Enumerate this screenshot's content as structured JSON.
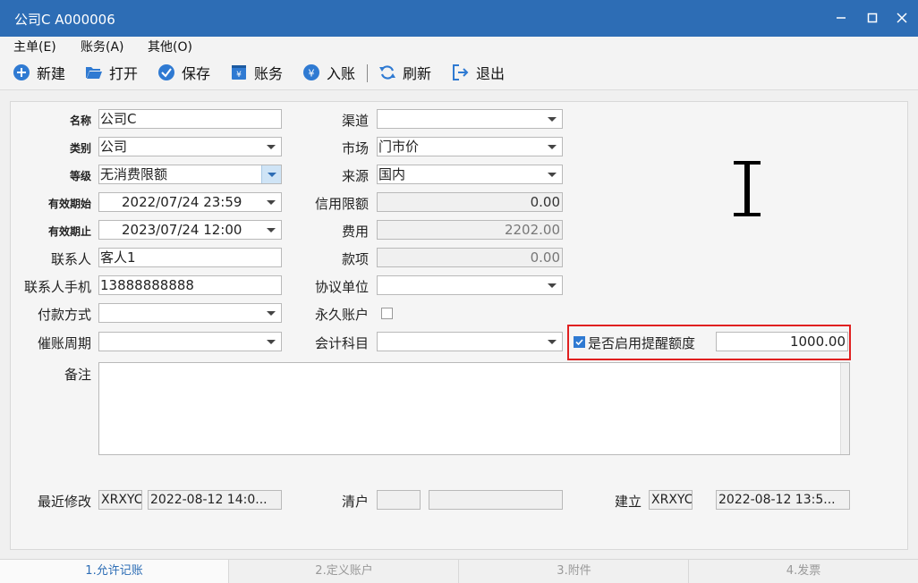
{
  "window": {
    "title": "公司C  A000006"
  },
  "menu": [
    {
      "label": "主单(E)"
    },
    {
      "label": "账务(A)"
    },
    {
      "label": "其他(O)"
    }
  ],
  "toolbar": {
    "new": "新建",
    "open": "打开",
    "save": "保存",
    "account": "账务",
    "post": "入账",
    "refresh": "刷新",
    "exit": "退出"
  },
  "form": {
    "name": {
      "label": "名称",
      "value": "公司C"
    },
    "category": {
      "label": "类别",
      "value": "公司"
    },
    "level": {
      "label": "等级",
      "value": "无消费限额"
    },
    "valid_from": {
      "label": "有效期始",
      "value": "2022/07/24 23:59"
    },
    "valid_to": {
      "label": "有效期止",
      "value": "2023/07/24 12:00"
    },
    "contact": {
      "label": "联系人",
      "value": "客人1"
    },
    "contact_phone": {
      "label": "联系人手机",
      "value": "13888888888"
    },
    "payment_method": {
      "label": "付款方式",
      "value": ""
    },
    "collection_cycle": {
      "label": "催账周期",
      "value": ""
    },
    "channel": {
      "label": "渠道",
      "value": ""
    },
    "market": {
      "label": "市场",
      "value": "门市价"
    },
    "source": {
      "label": "来源",
      "value": "国内"
    },
    "credit_limit": {
      "label": "信用限额",
      "value": "0.00"
    },
    "fee": {
      "label": "费用",
      "value": "2202.00"
    },
    "payment": {
      "label": "款项",
      "value": "0.00"
    },
    "agreement_unit": {
      "label": "协议单位",
      "value": ""
    },
    "permanent_account": {
      "label": "永久账户",
      "checked": false
    },
    "accounting_subject": {
      "label": "会计科目",
      "value": ""
    },
    "reminder": {
      "label": "是否启用提醒额度",
      "checked": true,
      "value": "1000.00"
    },
    "remarks": {
      "label": "备注",
      "value": ""
    },
    "last_modified": {
      "label": "最近修改",
      "user": "XRXYC",
      "time": "2022-08-12 14:0..."
    },
    "clearance": {
      "label": "清户",
      "user": "",
      "time": ""
    },
    "created": {
      "label": "建立",
      "user": "XRXYC",
      "time": "2022-08-12 13:5..."
    }
  },
  "tabs": [
    {
      "label": "1.允许记账",
      "active": true
    },
    {
      "label": "2.定义账户",
      "active": false
    },
    {
      "label": "3.附件",
      "active": false
    },
    {
      "label": "4.发票",
      "active": false
    }
  ],
  "colors": {
    "titlebar": "#2d6db5",
    "accent": "#2f7ad2",
    "highlight": "#e02020"
  }
}
